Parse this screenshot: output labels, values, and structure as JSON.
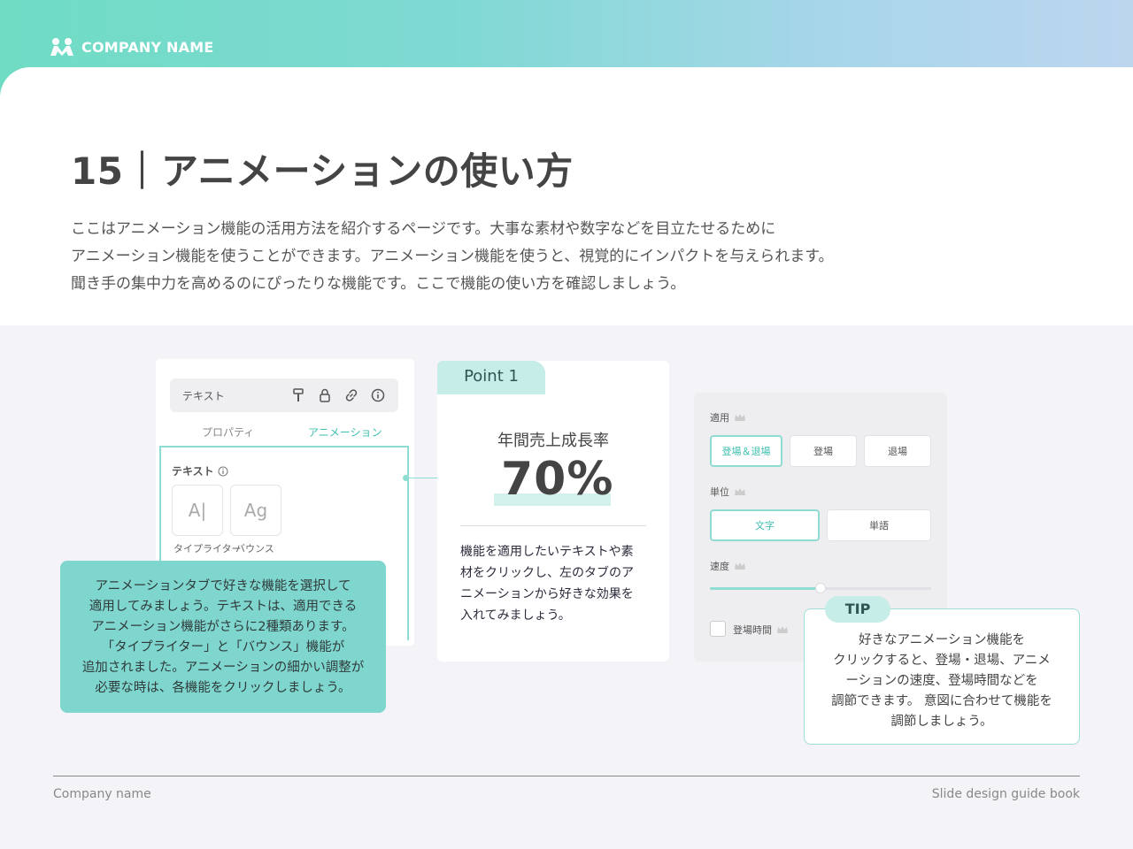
{
  "header": {
    "brand": "COMPANY NAME"
  },
  "page": {
    "title": "15｜アニメーションの使い方",
    "intro": [
      "ここはアニメーション機能の活用方法を紹介するページです。大事な素材や数字などを目立たせるために",
      "アニメーション機能を使うことができます。アニメーション機能を使うと、視覚的にインパクトを与えられます。",
      "聞き手の集中力を高めるのにぴったりな機能です。ここで機能の使い方を確認しましょう。"
    ]
  },
  "ui_panel": {
    "toolbar_label": "テキスト",
    "tabs": [
      "プロパティ",
      "アニメーション"
    ],
    "section_label": "テキスト",
    "effects": [
      {
        "glyph": "A|",
        "label": "タイプライター"
      },
      {
        "glyph": "Ag",
        "label": "バウンス"
      }
    ]
  },
  "callout": {
    "lines": [
      "アニメーションタブで好きな機能を選択して",
      "適用してみましょう。テキストは、適用できる",
      "アニメーション機能がさらに2種類あります。",
      "「タイプライター」と「バウンス」機能が",
      "追加されました。アニメーションの細かい調整が",
      "必要な時は、各機能をクリックしましょう。"
    ]
  },
  "point": {
    "tag": "Point 1",
    "subtitle": "年間売上成長率",
    "value": "70%",
    "desc": [
      "機能を適用したいテキストや素",
      "材をクリックし、左のタブのア",
      "ニメーションから好きな効果を",
      "入れてみましょう。"
    ]
  },
  "settings": {
    "apply_label": "適用",
    "apply_options": [
      "登場＆退場",
      "登場",
      "退場"
    ],
    "unit_label": "単位",
    "unit_options": [
      "文字",
      "単語"
    ],
    "speed_label": "速度",
    "speed_level": 0.5,
    "entrance_time_label": "登場時間"
  },
  "tip": {
    "tag": "TIP",
    "lines": [
      "好きなアニメーション機能を",
      "クリックすると、登場・退場、アニメ",
      "ーションの速度、登場時間などを",
      "調節できます。 意図に合わせて機能を",
      "調節しましょう。"
    ]
  },
  "footer": {
    "left": "Company name",
    "right": "Slide design guide book"
  },
  "colors": {
    "accent": "#7fd6ce",
    "accent_dark": "#3dbfb0",
    "text": "#444444"
  }
}
